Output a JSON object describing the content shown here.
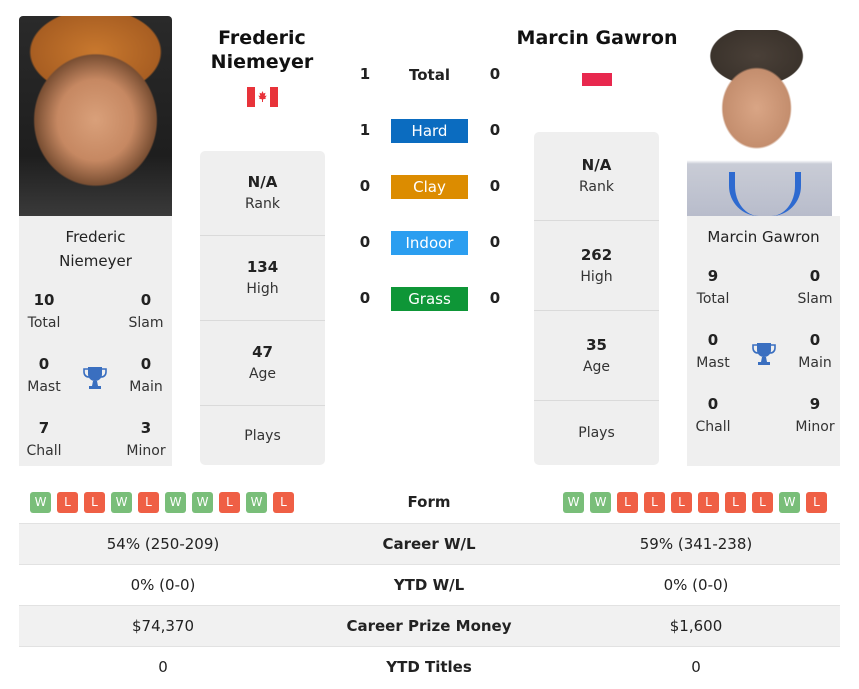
{
  "player1": {
    "name": "Frederic Niemeyer",
    "name_line1": "Frederic",
    "name_line2": "Niemeyer",
    "country_flag": "canada-flag",
    "photo": "player-photo",
    "titles": {
      "total": {
        "value": "10",
        "label": "Total"
      },
      "slam": {
        "value": "0",
        "label": "Slam"
      },
      "mast": {
        "value": "0",
        "label": "Mast"
      },
      "main": {
        "value": "0",
        "label": "Main"
      },
      "chall": {
        "value": "7",
        "label": "Chall"
      },
      "minor": {
        "value": "3",
        "label": "Minor"
      }
    },
    "stats": {
      "rank": {
        "value": "N/A",
        "label": "Rank"
      },
      "high": {
        "value": "134",
        "label": "High"
      },
      "age": {
        "value": "47",
        "label": "Age"
      },
      "plays": {
        "value": "",
        "label": "Plays"
      }
    },
    "form": [
      "W",
      "L",
      "L",
      "W",
      "L",
      "W",
      "W",
      "L",
      "W",
      "L"
    ],
    "career_wl": "54% (250-209)",
    "ytd_wl": "0% (0-0)",
    "career_prize": "$74,370",
    "ytd_titles": "0"
  },
  "player2": {
    "name": "Marcin Gawron",
    "country_flag": "poland-flag",
    "photo": "player-photo",
    "titles": {
      "total": {
        "value": "9",
        "label": "Total"
      },
      "slam": {
        "value": "0",
        "label": "Slam"
      },
      "mast": {
        "value": "0",
        "label": "Mast"
      },
      "main": {
        "value": "0",
        "label": "Main"
      },
      "chall": {
        "value": "0",
        "label": "Chall"
      },
      "minor": {
        "value": "9",
        "label": "Minor"
      }
    },
    "stats": {
      "rank": {
        "value": "N/A",
        "label": "Rank"
      },
      "high": {
        "value": "262",
        "label": "High"
      },
      "age": {
        "value": "35",
        "label": "Age"
      },
      "plays": {
        "value": "",
        "label": "Plays"
      }
    },
    "form": [
      "W",
      "W",
      "L",
      "L",
      "L",
      "L",
      "L",
      "L",
      "W",
      "L"
    ],
    "career_wl": "59% (341-238)",
    "ytd_wl": "0% (0-0)",
    "career_prize": "$1,600",
    "ytd_titles": "0"
  },
  "h2h": [
    {
      "label": "Total",
      "p1": "1",
      "p2": "0",
      "color": null
    },
    {
      "label": "Hard",
      "p1": "1",
      "p2": "0",
      "color": "#0b6cc0"
    },
    {
      "label": "Clay",
      "p1": "0",
      "p2": "0",
      "color": "#dc8c00"
    },
    {
      "label": "Indoor",
      "p1": "0",
      "p2": "0",
      "color": "#2b9ef0"
    },
    {
      "label": "Grass",
      "p1": "0",
      "p2": "0",
      "color": "#0e9637"
    }
  ],
  "comparison": {
    "form_label": "Form",
    "career_wl_label": "Career W/L",
    "ytd_wl_label": "YTD W/L",
    "career_prize_label": "Career Prize Money",
    "ytd_titles_label": "YTD Titles"
  },
  "colors": {
    "win": "#79be79",
    "loss": "#ef5f45",
    "trophy": "#3a6fc0",
    "panel": "#efefef"
  }
}
